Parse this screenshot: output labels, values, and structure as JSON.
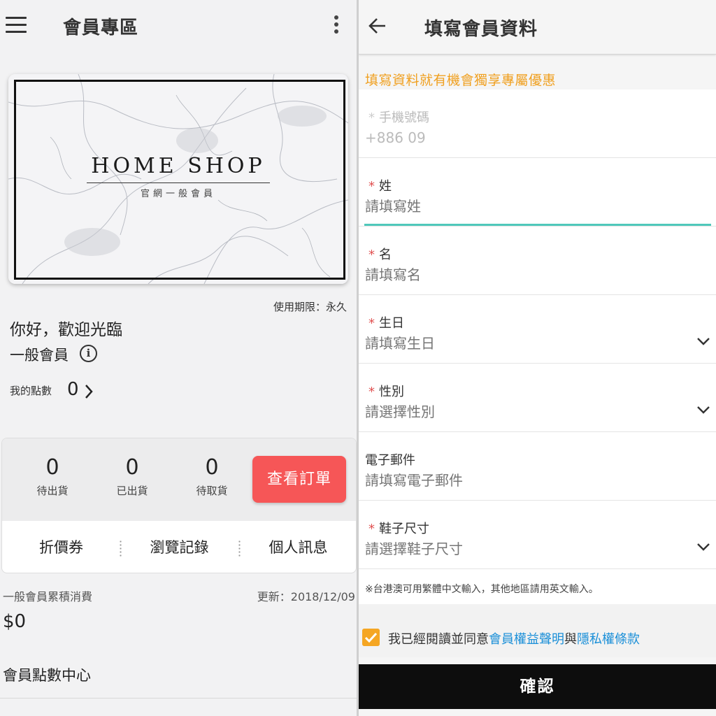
{
  "left": {
    "header": {
      "title": "會員專區"
    },
    "card": {
      "brand": "HOME SHOP",
      "subtitle": "官網一般會員"
    },
    "validity": "使用期限：永久",
    "greeting": "你好，歡迎光臨",
    "tier": "一般會員",
    "points": {
      "label": "我的點數",
      "value": "0"
    },
    "orders": {
      "stats": [
        {
          "count": "0",
          "label": "待出貨"
        },
        {
          "count": "0",
          "label": "已出貨"
        },
        {
          "count": "0",
          "label": "待取貨"
        }
      ],
      "view_button": "查看訂單"
    },
    "quick_links": [
      "折價券",
      "瀏覽記錄",
      "個人訊息"
    ],
    "spending": {
      "label": "一般會員累積消費",
      "updated": "更新：2018/12/09",
      "value": "$0"
    },
    "point_center": "會員點數中心"
  },
  "right": {
    "header": {
      "title": "填寫會員資料"
    },
    "promo": "填寫資料就有機會獨享專屬優惠",
    "fields": [
      {
        "label": "手機號碼",
        "value": "+886 09",
        "placeholder": ""
      },
      {
        "label": "姓",
        "value": "",
        "placeholder": "請填寫姓"
      },
      {
        "label": "名",
        "value": "",
        "placeholder": "請填寫名"
      },
      {
        "label": "生日",
        "value": "",
        "placeholder": "請填寫生日"
      },
      {
        "label": "性別",
        "value": "",
        "placeholder": "請選擇性別"
      },
      {
        "label": "電子郵件",
        "value": "",
        "placeholder": "請填寫電子郵件"
      },
      {
        "label": "鞋子尺寸",
        "value": "",
        "placeholder": "請選擇鞋子尺寸"
      }
    ],
    "required_mark": "*",
    "note": "※台港澳可用繁體中文輸入，其他地區請用英文輸入。",
    "agree": {
      "prefix": "我已經閱讀並同意",
      "link1": "會員權益聲明",
      "mid": "與",
      "link2": "隱私權條款",
      "checked": true
    },
    "confirm_button": "確認"
  },
  "colors": {
    "accent_red": "#f65657",
    "promo_orange": "#f0a020",
    "focus_teal": "#4fc8bb",
    "link_blue": "#1a8fd8",
    "checkbox_orange": "#f5a623",
    "confirm_black": "#0d0d0d"
  },
  "icons": [
    "menu-icon",
    "more-vert-icon",
    "info-icon",
    "chevron-right-icon",
    "back-arrow-icon",
    "chevron-down-icon",
    "check-icon"
  ]
}
